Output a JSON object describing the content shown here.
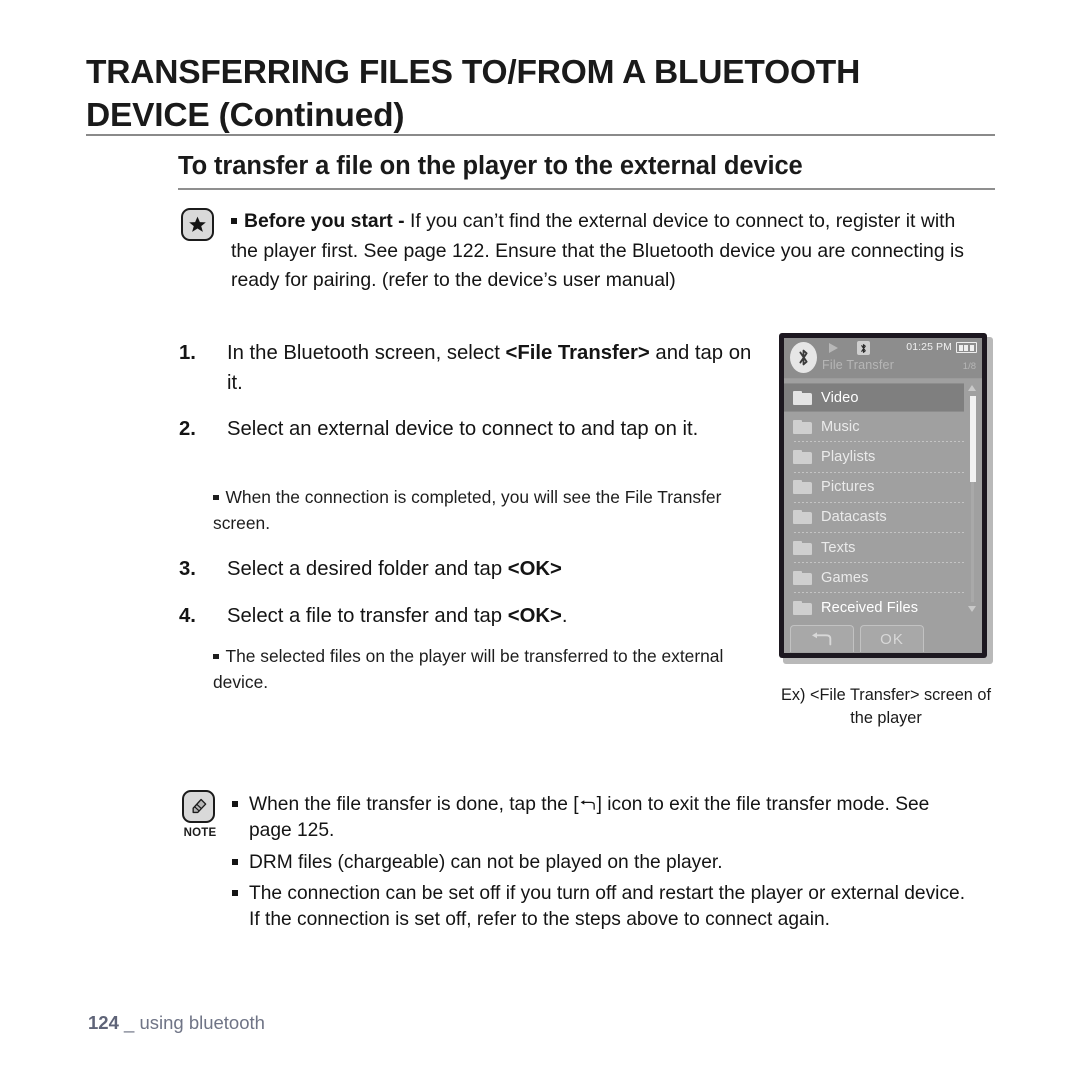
{
  "header": {
    "title": "TRANSFERRING FILES TO/FROM A BLUETOOTH\nDEVICE (Continued)",
    "subtitle": "To transfer a file on the player to the external device"
  },
  "before_you_start": {
    "icon": "star-icon",
    "label": "Before you start -",
    "text": "If you can’t find the external device to connect to, register it with the player first. See page 122. Ensure that the Bluetooth device you are connecting is ready for pairing. (refer to the device’s user manual)"
  },
  "steps": [
    {
      "number": "1.",
      "text_before": "In the Bluetooth screen, select ",
      "bold": "<File Transfer>",
      "text_after": " and tap on it."
    },
    {
      "number": "2.",
      "text_before": "Select an external device to connect to and tap on it.",
      "bold": "",
      "text_after": "",
      "subnote": "When the connection is completed, you will see the File Transfer screen."
    },
    {
      "number": "3.",
      "text_before": "Select a desired folder and tap ",
      "bold": "<OK>",
      "text_after": ""
    },
    {
      "number": "4.",
      "text_before": "Select a file to transfer and tap ",
      "bold": "<OK>",
      "text_after": ".",
      "subnote": "The selected files on the player will be transferred to the external device."
    }
  ],
  "device": {
    "status": {
      "bluetooth_badge_icon": "bluetooth-icon",
      "play_icon": "play-icon",
      "bluetooth_small_icon": "bluetooth-small-icon",
      "time": "01:25 PM",
      "battery_icon": "battery-icon",
      "title": "File Transfer",
      "count": "1/8"
    },
    "list": [
      {
        "label": "Video",
        "selected": true
      },
      {
        "label": "Music",
        "selected": false
      },
      {
        "label": "Playlists",
        "selected": false
      },
      {
        "label": "Pictures",
        "selected": false
      },
      {
        "label": "Datacasts",
        "selected": false
      },
      {
        "label": "Texts",
        "selected": false
      },
      {
        "label": "Games",
        "selected": false
      },
      {
        "label": "Received Files",
        "selected": false
      }
    ],
    "buttons": {
      "back_label": "",
      "back_icon": "back-arrow-icon",
      "ok_label": "OK"
    },
    "caption": "Ex) <File Transfer>\nscreen of the player"
  },
  "note": {
    "icon": "note-hand-icon",
    "label": "NOTE",
    "items": [
      {
        "part1": "When the file transfer is done, tap the [",
        "icon": "back-arrow-icon",
        "part2": "] icon to exit the file transfer mode. See page 125."
      },
      {
        "part1": "DRM files (chargeable) can not be played on the player.",
        "icon": "",
        "part2": ""
      },
      {
        "part1": "The connection can be set off if you turn off and restart the player or external device. If the connection is set off, refer to the steps above to connect again.",
        "icon": "",
        "part2": ""
      }
    ]
  },
  "footer": {
    "page": "124",
    "separator": "_",
    "section": "using bluetooth"
  },
  "colors": {
    "rule": "#8a8a8a",
    "footer_text": "#6f7486",
    "device_bezel": "#1d1820",
    "device_screen": "#a0a0a0",
    "device_selected_row": "#7f7f7f"
  }
}
